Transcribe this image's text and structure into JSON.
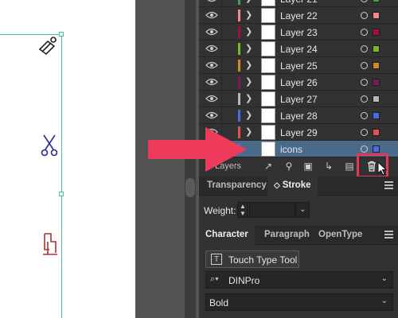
{
  "layers": {
    "rows": [
      {
        "name": "Layer 21",
        "color": "#3aa64b"
      },
      {
        "name": "Layer 22",
        "color": "#f08a8a"
      },
      {
        "name": "Layer 23",
        "color": "#a0103f"
      },
      {
        "name": "Layer 24",
        "color": "#7ab82b"
      },
      {
        "name": "Layer 25",
        "color": "#d08a2a"
      },
      {
        "name": "Layer 26",
        "color": "#7a1a5a"
      },
      {
        "name": "Layer 27",
        "color": "#b8b8b8"
      },
      {
        "name": "Layer 28",
        "color": "#4a6ae0"
      },
      {
        "name": "Layer 29",
        "color": "#e85050"
      },
      {
        "name": "icons",
        "color": "#4a6ae0",
        "selected": true
      }
    ],
    "footer_label": "Layers"
  },
  "annotations": {
    "arrow_color": "#ef3b5b",
    "highlight_color": "#e8365a"
  },
  "transparency_stroke": {
    "tabs": [
      "Transparency",
      "Stroke"
    ],
    "stroke_icon": "◇",
    "weight_label": "Weight:",
    "weight_value": ""
  },
  "character": {
    "tabs": [
      "Character",
      "Paragraph",
      "OpenType"
    ],
    "touch_type_label": "Touch Type Tool",
    "font_family": "DINPro",
    "font_style": "Bold"
  },
  "canvas": {
    "selection_color": "#45c596"
  }
}
